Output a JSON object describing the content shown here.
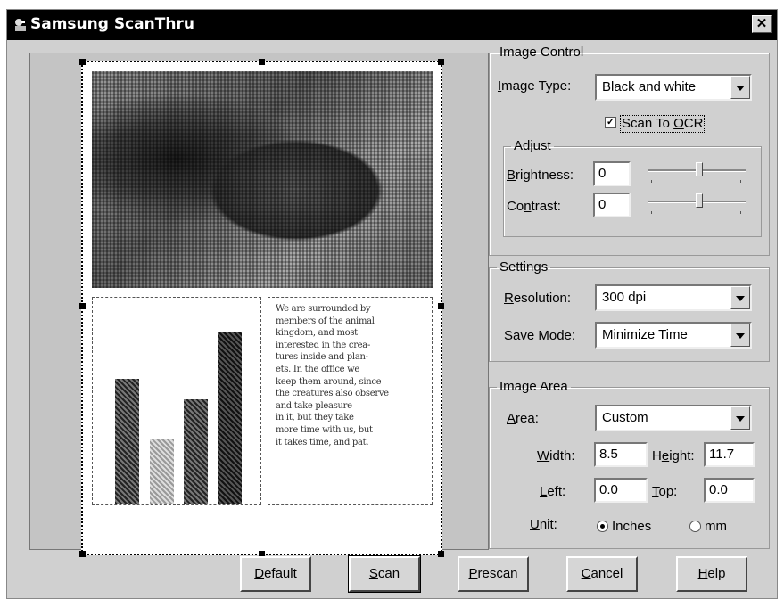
{
  "window": {
    "title": "Samsung ScanThru",
    "close_label": "✕"
  },
  "preview": {
    "text_lines": [
      "We are surrounded by",
      "members of the animal",
      "kingdom, and most",
      "interested in the crea-",
      "tures inside and plan-",
      "ets. In the office we",
      "keep them around, since",
      "the creatures also observe",
      "and take pleasure",
      "in it, but they take",
      "more time with us, but",
      "it takes time, and pat."
    ]
  },
  "image_control": {
    "legend": "Image Control",
    "image_type": {
      "label_u": "I",
      "label_rest": "mage Type:",
      "value": "Black and white"
    },
    "scan_to_ocr": {
      "checked": true,
      "label_a": "Scan To ",
      "label_u": "O",
      "label_b": "CR"
    },
    "adjust": {
      "legend": "Adjust",
      "brightness": {
        "label_u": "B",
        "label_rest": "rightness:",
        "value": "0",
        "level": 0.5
      },
      "contrast": {
        "label_a": "Co",
        "label_u": "n",
        "label_b": "trast:",
        "value": "0",
        "level": 0.5
      }
    }
  },
  "settings": {
    "legend": "Settings",
    "resolution": {
      "label_u": "R",
      "label_rest": "esolution:",
      "value": "300 dpi"
    },
    "save_mode": {
      "label_a": "Sa",
      "label_u": "v",
      "label_b": "e Mode:",
      "value": "Minimize Time"
    }
  },
  "image_area": {
    "legend": "Image Area",
    "area": {
      "label_u": "A",
      "label_rest": "rea:",
      "value": "Custom"
    },
    "width": {
      "label_u": "W",
      "label_rest": "idth:",
      "value": "8.5"
    },
    "height": {
      "label_a": "H",
      "label_u": "e",
      "label_b": "ight:",
      "value": "11.7"
    },
    "left": {
      "label_u": "L",
      "label_rest": "eft:",
      "value": "0.0"
    },
    "top": {
      "label_u": "T",
      "label_rest": "op:",
      "value": "0.0"
    },
    "unit": {
      "label_u": "U",
      "label_rest": "nit:",
      "inches": "Inches",
      "mm": "mm",
      "selected": "Inches"
    }
  },
  "buttons": {
    "default": {
      "u": "D",
      "rest": "efault"
    },
    "scan": {
      "u": "S",
      "rest": "can"
    },
    "prescan": {
      "u": "P",
      "rest": "rescan"
    },
    "cancel": {
      "u": "C",
      "rest": "ancel"
    },
    "help": {
      "u": "H",
      "rest": "elp"
    }
  }
}
